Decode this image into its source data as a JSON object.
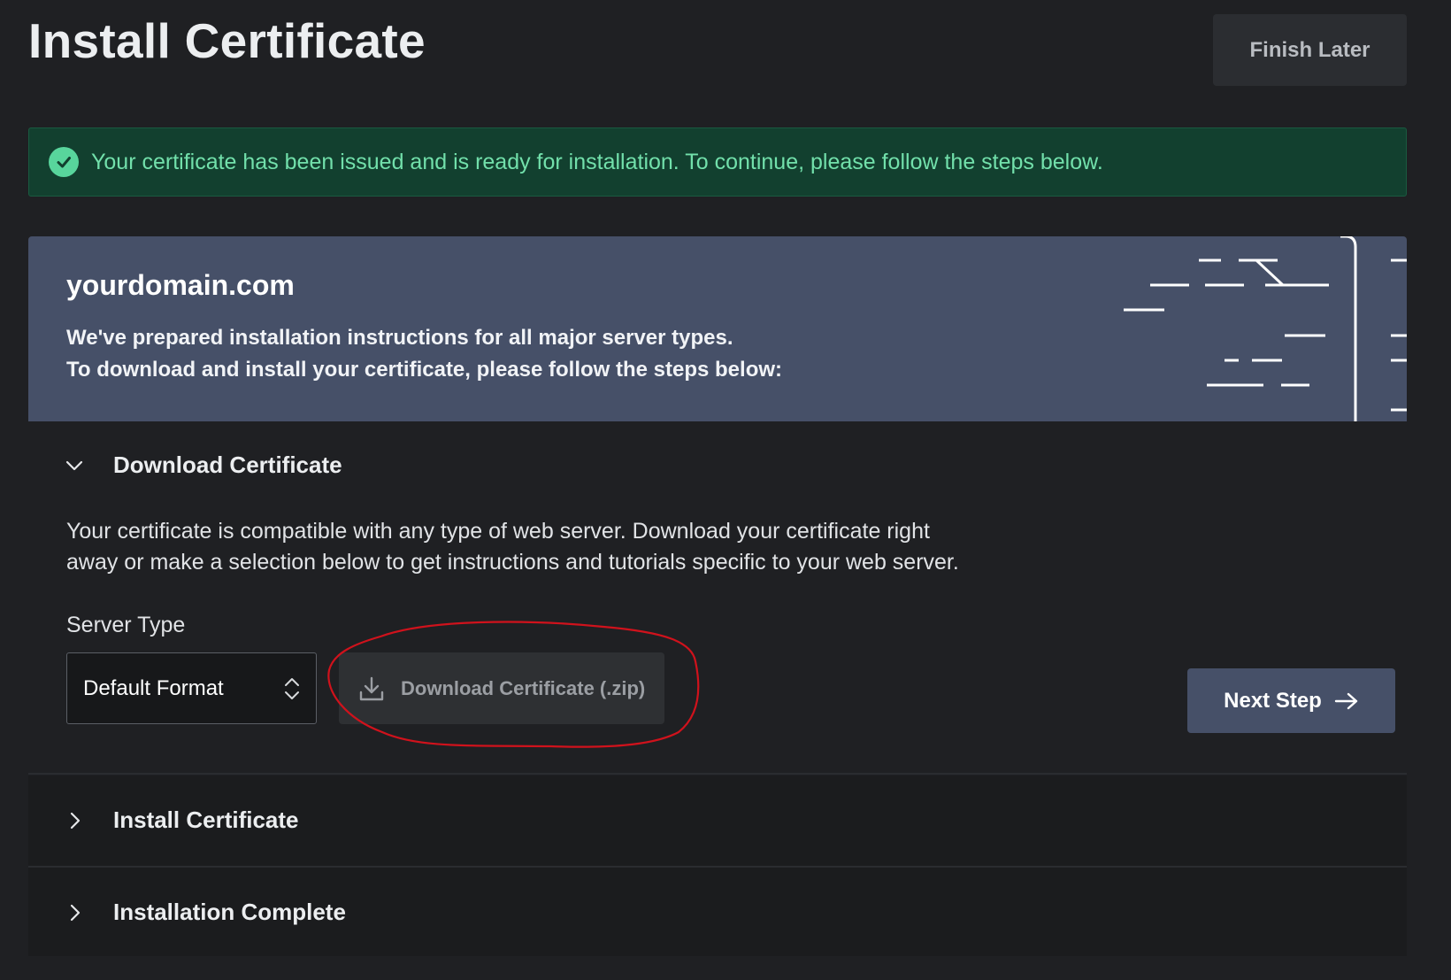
{
  "header": {
    "title": "Install Certificate",
    "finish_later_label": "Finish Later"
  },
  "banner": {
    "icon": "check-circle-icon",
    "message": "Your certificate has been issued and is ready for installation. To continue, please follow the steps below."
  },
  "hero": {
    "domain": "yourdomain.com",
    "line1": "We've prepared installation instructions for all major server types.",
    "line2": "To download and install your certificate, please follow the steps below:"
  },
  "steps": [
    {
      "label": "Download Certificate",
      "expanded": true,
      "icon": "chevron-down-icon",
      "body_line1": "Your certificate is compatible with any type of web server. Download your certificate right",
      "body_line2": "away or make a selection below to get instructions and tutorials specific to your web server.",
      "server_type_label": "Server Type",
      "server_type_value": "Default Format",
      "download_label": "Download Certificate (.zip)",
      "next_label": "Next Step"
    },
    {
      "label": "Install Certificate",
      "expanded": false,
      "icon": "chevron-right-icon"
    },
    {
      "label": "Installation Complete",
      "expanded": false,
      "icon": "chevron-right-icon"
    }
  ],
  "colors": {
    "background": "#1f2023",
    "banner_bg": "#12402f",
    "banner_text": "#72e0ab",
    "hero_bg": "#465068",
    "annotation": "#d0121c"
  }
}
